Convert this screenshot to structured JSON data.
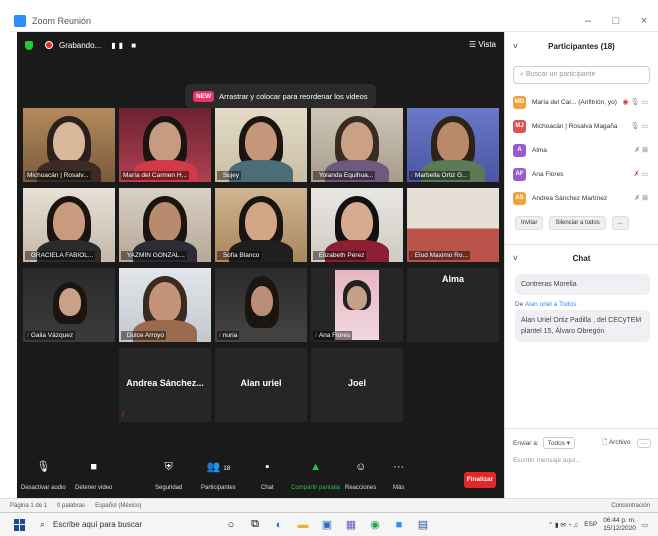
{
  "window": {
    "title": "Zoom Reunión",
    "minimize": "–",
    "maximize": "□",
    "close": "×"
  },
  "top": {
    "recording_label": "Grabando...",
    "recording_controls": "▮▮ ■",
    "view_label": "☰ Vista"
  },
  "tooltip": {
    "badge": "NEW",
    "text": "Arrastrar y colocar para reordenar los videos"
  },
  "tiles": [
    {
      "name": "Michoacán | Rosalv...",
      "muted": false
    },
    {
      "name": "María del Carmen H...",
      "muted": false
    },
    {
      "name": "Sujey",
      "muted": true
    },
    {
      "name": "Yolanda Equihua...",
      "muted": true
    },
    {
      "name": "Marbella Ortiz G...",
      "muted": true
    },
    {
      "name": "GRACIELA FABIOL...",
      "muted": true
    },
    {
      "name": "YAZMIN GONZAL...",
      "muted": true
    },
    {
      "name": "Sofia Blanco",
      "muted": true
    },
    {
      "name": "Elizabeth Pérez",
      "muted": true
    },
    {
      "name": "Elud Maximo Ro...",
      "muted": true
    },
    {
      "name": "Galia Vázquez",
      "muted": true
    },
    {
      "name": "Dulce Arroyo",
      "muted": true
    },
    {
      "name": "nuria",
      "muted": true
    },
    {
      "name": "Ana Flores",
      "muted": true
    },
    {
      "name": "Alma",
      "muted": false
    },
    {
      "name": "Andrea Sánchez...",
      "muted": true
    },
    {
      "name": "Alan uriel",
      "muted": false
    },
    {
      "name": "Joel",
      "muted": false
    }
  ],
  "toolbar": {
    "audio": "Desactivar audio",
    "video": "Detener video",
    "security": "Seguridad",
    "participants": "Participantes",
    "participants_count": "18",
    "chat": "Chat",
    "share": "Compartir pantalla",
    "reactions": "Reacciones",
    "more": "Más",
    "end": "Finalizar"
  },
  "participants_panel": {
    "title": "Participantes (18)",
    "search_placeholder": "Buscar un participante",
    "list": [
      {
        "initials": "MD",
        "name": "María del Car... (Anfitrión, yo)",
        "color": "#f0a03c"
      },
      {
        "initials": "MJ",
        "name": "Michoacán | Rosalva Magaña",
        "color": "#d9534f"
      },
      {
        "initials": "A",
        "name": "Alma",
        "color": "#9b59d0"
      },
      {
        "initials": "AF",
        "name": "Ana Flores",
        "color": "#9b59d0"
      },
      {
        "initials": "AS",
        "name": "Andrea Sánchez Martínez",
        "color": "#f0a03c"
      }
    ],
    "invite": "Invitar",
    "mute_all": "Silenciar a todos",
    "more": "..."
  },
  "chat": {
    "title": "Chat",
    "msg1": "Contreras Morelia",
    "from_prefix": "De",
    "from_name": "Alan uriel",
    "from_suffix": "a Todos",
    "msg2": "Alan Uriel Ortiz Padilla , del CECyTEM plantel 15, Álvaro Obregón",
    "to_label": "Enviar a:",
    "to_value": "Todos ▾",
    "file": "Archivo",
    "more": "···",
    "input_placeholder": "Escribir mensaje aquí..."
  },
  "statusbar": {
    "page": "Página 1 de 1",
    "words": "0 palabras",
    "lang": "Español (México)",
    "focus": "Concentración"
  },
  "taskbar": {
    "search": "Escribe aquí para buscar",
    "lang": "ESP",
    "time": "06:44 p. m.",
    "date": "15/12/2020"
  }
}
